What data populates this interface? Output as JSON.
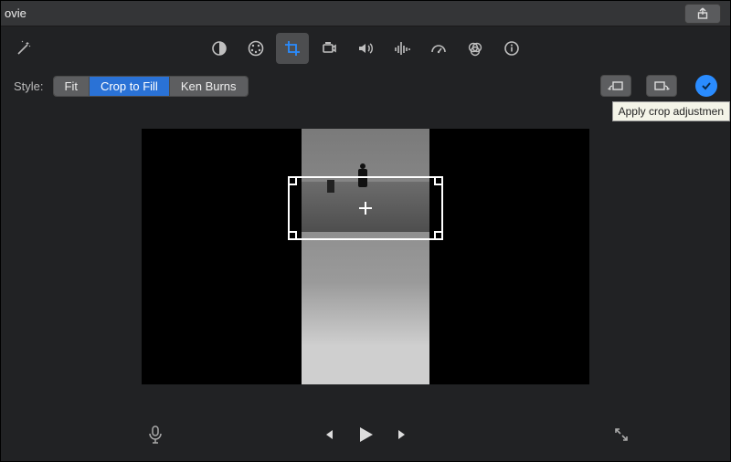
{
  "titlebar": {
    "title": "ovie"
  },
  "toolbar_icons": {
    "wand": "wand",
    "color_balance": "color-balance",
    "color_wheel": "color-wheel",
    "crop": "crop",
    "stabilize": "stabilize",
    "volume": "volume",
    "noise": "noise-reduction",
    "speed": "speed",
    "color_filter": "color-filter",
    "info": "info"
  },
  "style": {
    "label": "Style:",
    "options": [
      "Fit",
      "Crop to Fill",
      "Ken Burns"
    ],
    "selected": "Crop to Fill"
  },
  "apply": {
    "tooltip": "Apply crop adjustmen"
  },
  "playbar": {
    "mic": "microphone",
    "prev": "previous",
    "play": "play",
    "next": "next",
    "fullscreen": "fullscreen"
  }
}
